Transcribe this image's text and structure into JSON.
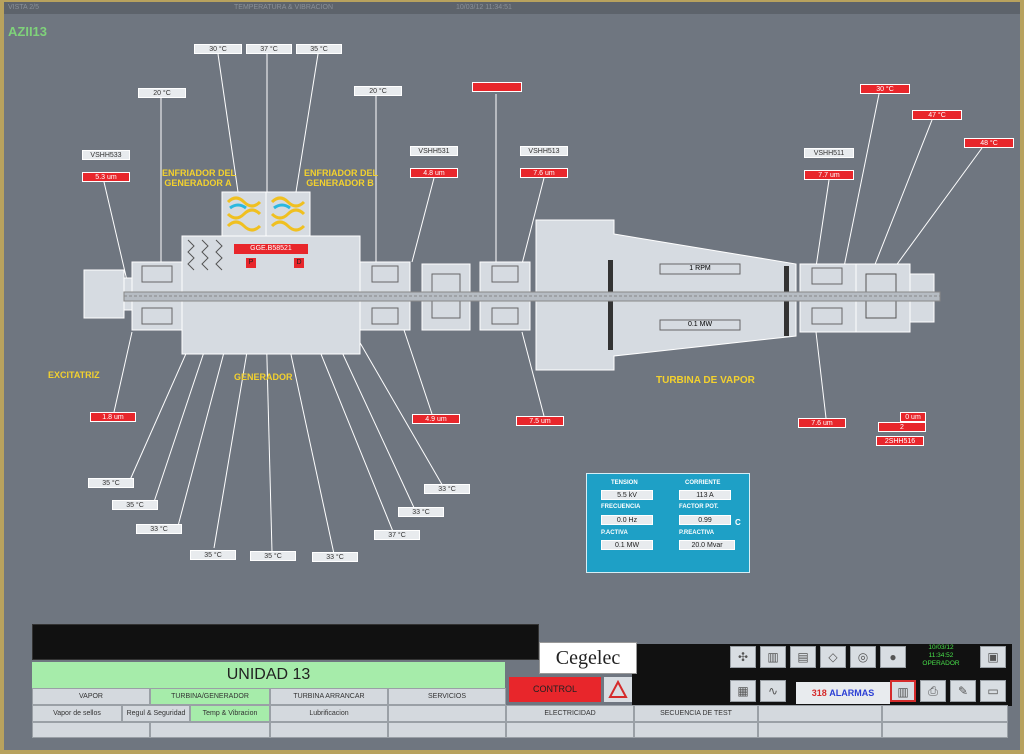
{
  "window": {
    "title_left": "VISTA 2/5",
    "title_center": "TEMPERATURA & VIBRACION",
    "datetime": "10/03/12  11:34:51",
    "screen_id": "AZII13"
  },
  "diagram": {
    "labels": {
      "excitatriz": "EXCITATRIZ",
      "generador": "GENERADOR",
      "turbina": "TURBINA DE VAPOR",
      "enfriador_a": "ENFRIADOR DEL\nGENERADOR A",
      "enfriador_b": "ENFRIADOR DEL\nGENERADOR B",
      "gen_tag": "GGE.B58521",
      "p_label": "P",
      "d_label": "D",
      "rpm": "1 RPM",
      "mw": "0.1 MW"
    },
    "temp_top": [
      "30 °C",
      "37 °C",
      "35 °C",
      "20 °C",
      "20 °C",
      "30 °C",
      "47 °C",
      "48 °C"
    ],
    "vib_ids": [
      "VSHH533",
      "VSHH531",
      "VSHH513",
      "VSHH511"
    ],
    "vib_values": [
      "5.3 um",
      "4.8 um",
      "7.6 um",
      "7.7 um"
    ],
    "vib_bottom": [
      "1.8 um",
      "4.9 um",
      "7.5 um",
      "7.6 um"
    ],
    "red_blank": "",
    "right_bottom": [
      "0 um",
      "2",
      "2SHH516"
    ],
    "temp_bottom": [
      "35 °C",
      "35 °C",
      "33 °C",
      "35 °C",
      "35 °C",
      "33 °C",
      "37 °C",
      "33 °C",
      "33 °C"
    ]
  },
  "electrical": {
    "tension_label": "TENSION",
    "tension": "5.5 kV",
    "corriente_label": "CORRIENTE",
    "corriente": "113 A",
    "frecuencia_label": "FRECUENCIA",
    "frecuencia": "0.0 Hz",
    "factor_label": "FACTOR POT.",
    "factor": "0.99",
    "pactiva_label": "P.ACTIVA",
    "pactiva": "0.1 MW",
    "preactiva_label": "P.REACTIVA",
    "preactiva": "20.0 Mvar",
    "side": "C"
  },
  "footer": {
    "unit": "UNIDAD 13",
    "logo": "Cegelec",
    "control": "CONTROL",
    "clock": {
      "date": "10/03/12",
      "time": "11:34:52",
      "user": "OPERADOR"
    },
    "alarms_count": "318",
    "alarms_label": "ALARMAS",
    "nav_row1": [
      "VAPOR",
      "TURBINA/GENERADOR",
      "TURBINA ARRANCAR",
      "SERVICIOS"
    ],
    "nav_row2": [
      "Vapor de sellos",
      "Regul & Seguridad",
      "Temp & Vibracion",
      "Lubrificacion"
    ],
    "nav_right": [
      "ELECTRICIDAD",
      "SECUENCIA DE TEST"
    ]
  }
}
